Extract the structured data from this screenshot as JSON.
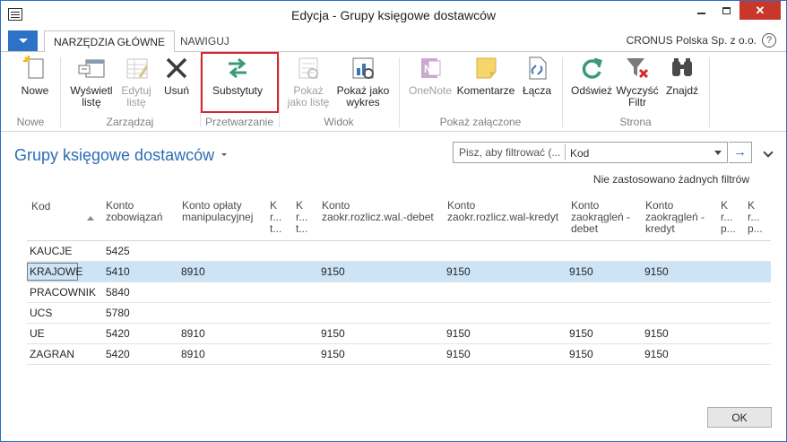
{
  "window": {
    "title": "Edycja - Grupy księgowe dostawców",
    "minimize": "",
    "maximize": "",
    "close": "✕"
  },
  "ribbon_tabs": {
    "active": "NARZĘDZIA GŁÓWNE",
    "navigate": "NAWIGUJ",
    "company": "CRONUS Polska Sp. z o.o.",
    "help": "?"
  },
  "ribbon": {
    "new": "Nowe",
    "list_view": "Wyświetl\nlistę",
    "list_edit": "Edytuj\nlistę",
    "delete": "Usuń",
    "substitutes": "Substytuty",
    "show_as_list": "Pokaż\njako listę",
    "show_as_chart": "Pokaż jako\nwykres",
    "onenote": "OneNote",
    "comments": "Komentarze",
    "links": "Łącza",
    "refresh": "Odśwież",
    "clear_filter": "Wyczyść\nFiltr",
    "find": "Znajdź",
    "groups": {
      "new": "Nowe",
      "manage": "Zarządzaj",
      "process": "Przetwarzanie",
      "view": "Widok",
      "attachments": "Pokaż załączone",
      "page": "Strona"
    }
  },
  "page": {
    "title": "Grupy księgowe dostawców",
    "filter_placeholder": "Pisz, aby filtrować (...",
    "filter_field": "Kod",
    "filter_go": "→",
    "no_filters": "Nie zastosowano żadnych filtrów"
  },
  "columns": [
    "Kod",
    "Konto\nzobowiązań",
    "Konto opłaty\nmanipulacyjnej",
    "K\nr...\nt...",
    "K\nr...\nt...",
    "Konto\nzaokr.rozlicz.wal.-debet",
    "Konto\nzaokr.rozlicz.wal-kredyt",
    "Konto\nzaokrągleń -\ndebet",
    "Konto\nzaokrągleń -\nkredyt",
    "K\nr...\np...",
    "K\nr...\np..."
  ],
  "rows": [
    {
      "kod": "KAUCJE",
      "payables": "5425",
      "service_charge": "",
      "fcy_debit": "",
      "fcy_credit": "",
      "inv_debit": "",
      "inv_credit": ""
    },
    {
      "kod": "KRAJOWE",
      "payables": "5410",
      "service_charge": "8910",
      "fcy_debit": "9150",
      "fcy_credit": "9150",
      "inv_debit": "9150",
      "inv_credit": "9150"
    },
    {
      "kod": "PRACOWNIK",
      "payables": "5840",
      "service_charge": "",
      "fcy_debit": "",
      "fcy_credit": "",
      "inv_debit": "",
      "inv_credit": ""
    },
    {
      "kod": "UCS",
      "payables": "5780",
      "service_charge": "",
      "fcy_debit": "",
      "fcy_credit": "",
      "inv_debit": "",
      "inv_credit": ""
    },
    {
      "kod": "UE",
      "payables": "5420",
      "service_charge": "8910",
      "fcy_debit": "9150",
      "fcy_credit": "9150",
      "inv_debit": "9150",
      "inv_credit": "9150"
    },
    {
      "kod": "ZAGRAN",
      "payables": "5420",
      "service_charge": "8910",
      "fcy_debit": "9150",
      "fcy_credit": "9150",
      "inv_debit": "9150",
      "inv_credit": "9150"
    }
  ],
  "footer": {
    "ok": "OK"
  },
  "colors": {
    "accent": "#2c72c7",
    "title_blue": "#2c6cb5",
    "selected_row": "#cde4f7",
    "highlight_box": "#d9262a"
  }
}
